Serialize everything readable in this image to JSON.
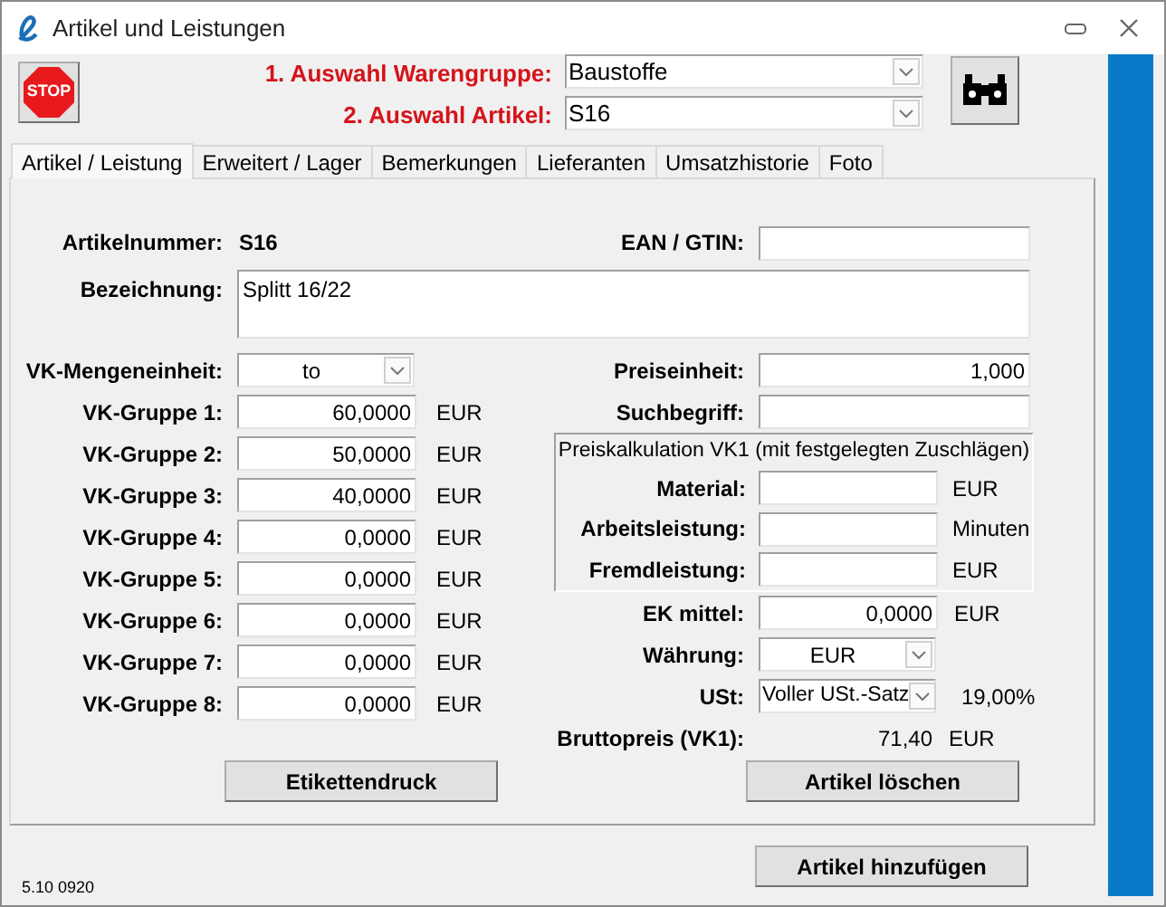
{
  "window": {
    "title": "Artikel und Leistungen"
  },
  "stop_button": {
    "label": "STOP"
  },
  "selection": [
    {
      "label": "1. Auswahl Warengruppe:",
      "value": "Baustoffe"
    },
    {
      "label": "2. Auswahl Artikel:",
      "value": "S16"
    }
  ],
  "tabs": [
    {
      "label": "Artikel / Leistung",
      "selected": true
    },
    {
      "label": "Erweitert / Lager",
      "selected": false
    },
    {
      "label": "Bemerkungen",
      "selected": false
    },
    {
      "label": "Lieferanten",
      "selected": false
    },
    {
      "label": "Umsatzhistorie",
      "selected": false
    },
    {
      "label": "Foto",
      "selected": false
    }
  ],
  "article_number": {
    "label": "Artikelnummer:",
    "value": "S16"
  },
  "ean": {
    "label": "EAN / GTIN:"
  },
  "description": {
    "label": "Bezeichnung:",
    "value": "Splitt 16/22"
  },
  "sales_unit": {
    "label": "VK-Mengeneinheit:",
    "value": "to"
  },
  "price_groups": [
    {
      "label": "VK-Gruppe 1:",
      "value": "60,0000",
      "unit": "EUR"
    },
    {
      "label": "VK-Gruppe 2:",
      "value": "50,0000",
      "unit": "EUR"
    },
    {
      "label": "VK-Gruppe 3:",
      "value": "40,0000",
      "unit": "EUR"
    },
    {
      "label": "VK-Gruppe 4:",
      "value": "0,0000",
      "unit": "EUR"
    },
    {
      "label": "VK-Gruppe 5:",
      "value": "0,0000",
      "unit": "EUR"
    },
    {
      "label": "VK-Gruppe 6:",
      "value": "0,0000",
      "unit": "EUR"
    },
    {
      "label": "VK-Gruppe 7:",
      "value": "0,0000",
      "unit": "EUR"
    },
    {
      "label": "VK-Gruppe 8:",
      "value": "0,0000",
      "unit": "EUR"
    }
  ],
  "right_fields": [
    {
      "label": "Preiseinheit:",
      "value": "1,000"
    },
    {
      "label": "Suchbegriff:"
    }
  ],
  "calculation": {
    "title": "Preiskalkulation VK1 (mit festgelegten Zuschlägen)",
    "rows": [
      {
        "label": "Material:",
        "unit": "EUR"
      },
      {
        "label": "Arbeitsleistung:",
        "unit": "Minuten"
      },
      {
        "label": "Fremdleistung:",
        "unit": "EUR"
      }
    ]
  },
  "lower_fields": [
    {
      "kind": "input",
      "label": "EK mittel:",
      "value": "0,0000",
      "unit": "EUR"
    },
    {
      "kind": "dropdown",
      "label": "Währung:",
      "value": "EUR"
    },
    {
      "kind": "dropdown",
      "label": "USt:",
      "value": "Voller USt.-Satz",
      "unit": "19,00%"
    },
    {
      "kind": "readout",
      "label": "Bruttopreis (VK1):",
      "value": "71,40",
      "unit": "EUR"
    }
  ],
  "panel_buttons": [
    "Etikettendruck",
    "Artikel löschen"
  ],
  "add_button": "Artikel hinzufügen",
  "version": "5.10 0920"
}
